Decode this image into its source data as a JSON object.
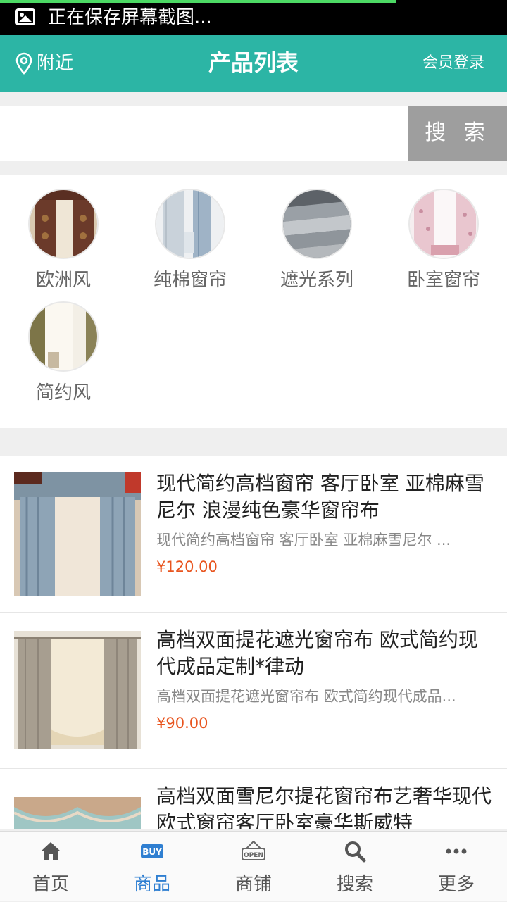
{
  "status_bar": {
    "text": "正在保存屏幕截图..."
  },
  "header": {
    "location": "附近",
    "title": "产品列表",
    "login": "会员登录"
  },
  "search": {
    "placeholder": "",
    "button": "搜 索"
  },
  "categories": [
    {
      "label": "欧洲风"
    },
    {
      "label": "纯棉窗帘"
    },
    {
      "label": "遮光系列"
    },
    {
      "label": "卧室窗帘"
    },
    {
      "label": "简约风"
    }
  ],
  "products": [
    {
      "name": "现代简约高档窗帘 客厅卧室 亚棉麻雪尼尔 浪漫纯色豪华窗帘布",
      "desc": "现代简约高档窗帘 客厅卧室 亚棉麻雪尼尔 ...",
      "price": "¥120.00"
    },
    {
      "name": "高档双面提花遮光窗帘布 欧式简约现代成品定制*律动",
      "desc": "高档双面提花遮光窗帘布 欧式简约现代成品...",
      "price": "¥90.00"
    },
    {
      "name": "高档双面雪尼尔提花窗帘布艺奢华现代欧式窗帘客厅卧室豪华斯威特",
      "desc": "",
      "price": ""
    }
  ],
  "tabbar": [
    {
      "label": "首页",
      "icon": "home-icon"
    },
    {
      "label": "商品",
      "icon": "buy-icon"
    },
    {
      "label": "商铺",
      "icon": "open-shop-icon"
    },
    {
      "label": "搜索",
      "icon": "search-icon"
    },
    {
      "label": "更多",
      "icon": "more-icon"
    }
  ],
  "colors": {
    "header": "#2cb5a5",
    "price": "#e8541e",
    "active_tab": "#2f7fd1",
    "search_button": "#9e9e9e"
  }
}
